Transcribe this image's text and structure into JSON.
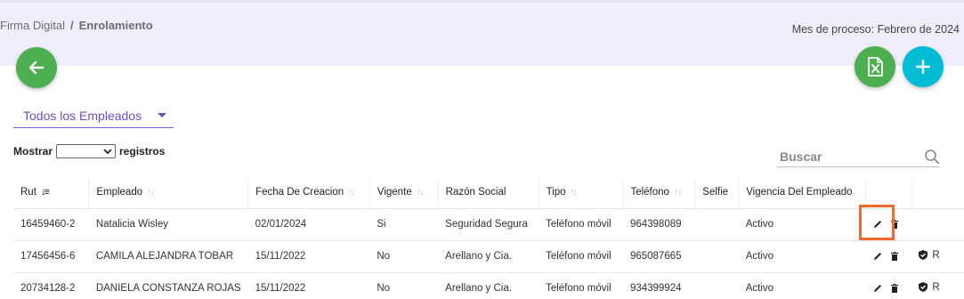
{
  "breadcrumb": {
    "root": "Firma Digital",
    "separator": "/",
    "current": "Enrolamiento"
  },
  "process_month": "Mes de proceso: Febrero de 2024",
  "filter": {
    "selected": "Todos los Empleados"
  },
  "show_records": {
    "prefix": "Mostrar",
    "suffix": "registros"
  },
  "search": {
    "placeholder": "Buscar"
  },
  "table": {
    "headers": [
      "Rut",
      "Empleado",
      "Fecha De Creacion",
      "Vigente",
      "Razón Social",
      "Tipo",
      "Teléfono",
      "Selfie",
      "Vigencia Del Empleado",
      "",
      ""
    ],
    "rows": [
      [
        "16459460-2",
        "Natalicia Wisley",
        "02/01/2024",
        "Si",
        "Seguridad Segura",
        "Teléfono móvil",
        "964398089",
        "",
        "Activo"
      ],
      [
        "17456456-6",
        "CAMILA ALEJANDRA TOBAR",
        "15/11/2022",
        "No",
        "Arellano y Cia.",
        "Teléfono móvil",
        "965087665",
        "",
        "Activo"
      ],
      [
        "20734128-2",
        "DANIELA CONSTANZA ROJAS",
        "15/11/2022",
        "No",
        "Arellano y Cia.",
        "Teléfono móvil",
        "934399924",
        "",
        "Activo"
      ]
    ],
    "row_extra_label": [
      "",
      "R",
      "R"
    ]
  },
  "colors": {
    "accent": "#6a4fc9",
    "green": "#4caf50",
    "cyan": "#00bcd4",
    "highlight": "#f06a30"
  },
  "icons": [
    "arrow-left-icon",
    "excel-file-icon",
    "plus-icon",
    "search-icon",
    "pencil-icon",
    "trash-icon",
    "shield-check-icon"
  ]
}
